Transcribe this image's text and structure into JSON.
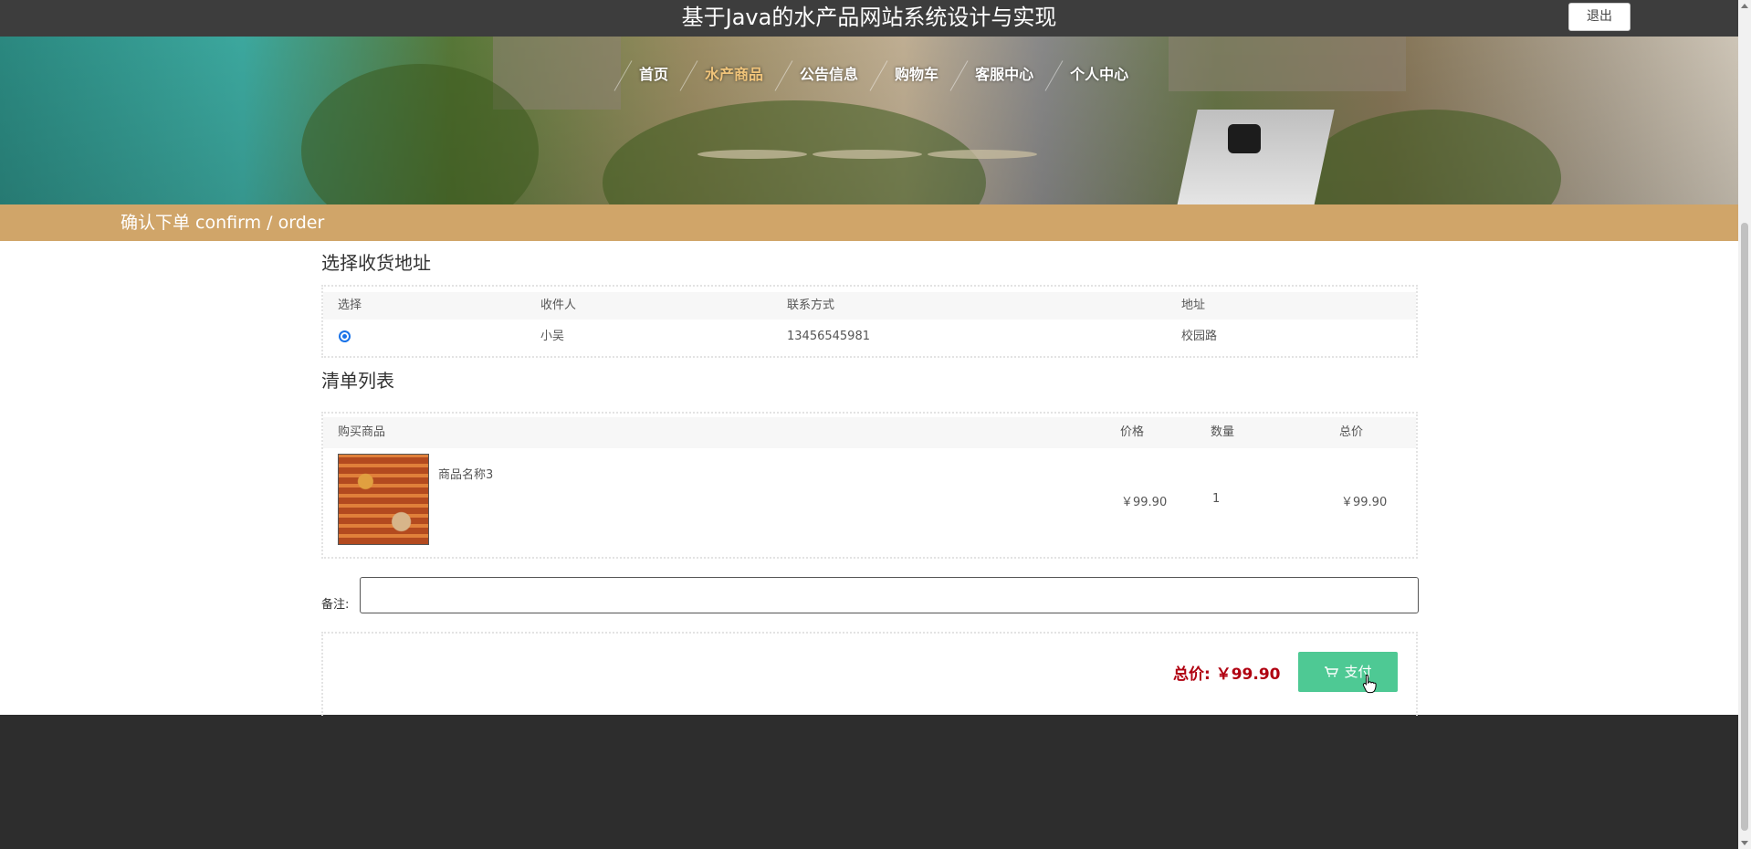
{
  "header": {
    "site_title": "基于Java的水产品网站系统设计与实现",
    "logout_label": "退出"
  },
  "nav": {
    "items": [
      {
        "label": "首页",
        "active": false
      },
      {
        "label": "水产商品",
        "active": true
      },
      {
        "label": "公告信息",
        "active": false
      },
      {
        "label": "购物车",
        "active": false
      },
      {
        "label": "客服中心",
        "active": false
      },
      {
        "label": "个人中心",
        "active": false
      }
    ],
    "active_color": "#f0c47a"
  },
  "section": {
    "title": "确认下单  confirm / order",
    "band_color": "#d0a569"
  },
  "address": {
    "heading": "选择收货地址",
    "columns": [
      "选择",
      "收件人",
      "联系方式",
      "地址"
    ],
    "rows": [
      {
        "selected": true,
        "recipient": "小吴",
        "phone": "13456545981",
        "address": "校园路"
      }
    ]
  },
  "cart": {
    "heading": "清单列表",
    "columns": [
      "购买商品",
      "价格",
      "数量",
      "总价"
    ],
    "items": [
      {
        "name": "商品名称3",
        "price": "￥99.90",
        "quantity": "1",
        "subtotal": "￥99.90",
        "image_icon": "seafood-dish-image"
      }
    ]
  },
  "note": {
    "label": "备注:",
    "value": "",
    "placeholder": ""
  },
  "summary": {
    "total_label": "总价: ￥99.90",
    "pay_label": "支付",
    "pay_icon": "cart-icon",
    "pay_color": "#4ec994",
    "total_color": "#b00010"
  }
}
